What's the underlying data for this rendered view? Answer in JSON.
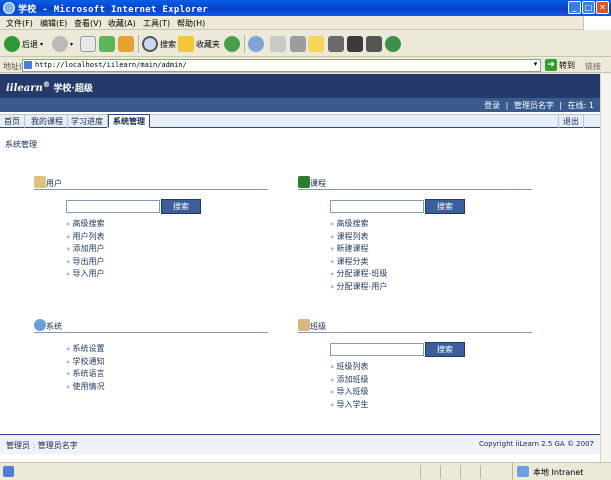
{
  "window": {
    "title": "学校 - Microsoft Internet Explorer",
    "minimize": "_",
    "maximize": "□",
    "close": "✕"
  },
  "menu": [
    "文件(F)",
    "编辑(E)",
    "查看(V)",
    "收藏(A)",
    "工具(T)",
    "帮助(H)"
  ],
  "toolbar": {
    "back": "后退",
    "search": "搜索",
    "favorites": "收藏夹"
  },
  "address": {
    "label": "地址(D)",
    "url": "http://localhost/iilearn/main/admin/",
    "go": "转到",
    "links": "链接"
  },
  "banner": {
    "logo": "iilearn",
    "reg": "®",
    "school": "学校·超级"
  },
  "subbar": {
    "logout": "登录",
    "sep1": "|",
    "admin": "管理员名字",
    "sep2": "|",
    "online": "在线: 1"
  },
  "tabs": {
    "home": "首页",
    "my_courses": "我的课程",
    "progress": "学习进度",
    "admin": "系统管理",
    "exit": "退出"
  },
  "breadcrumb": "系统管理",
  "sections": {
    "users": {
      "title": "用户",
      "button": "搜索",
      "links": [
        "高级搜索",
        "用户列表",
        "添加用户",
        "导出用户",
        "导入用户"
      ]
    },
    "courses": {
      "title": "课程",
      "button": "搜索",
      "links": [
        "高级搜索",
        "课程列表",
        "新建课程",
        "课程分类",
        "分配课程-班级",
        "分配课程-用户"
      ]
    },
    "system": {
      "title": "系统",
      "links": [
        "系统设置",
        "学校通知",
        "系统语言",
        "使用情况"
      ]
    },
    "classes": {
      "title": "班级",
      "button": "搜索",
      "links": [
        "班级列表",
        "添加班级",
        "导入班级",
        "导入学生"
      ]
    }
  },
  "footer": {
    "role": "管理员",
    "name": "管理员名字",
    "copyright": "Copyright iiLearn 2.5 GA © 2007"
  },
  "status": {
    "zone": "本地 Intranet"
  }
}
